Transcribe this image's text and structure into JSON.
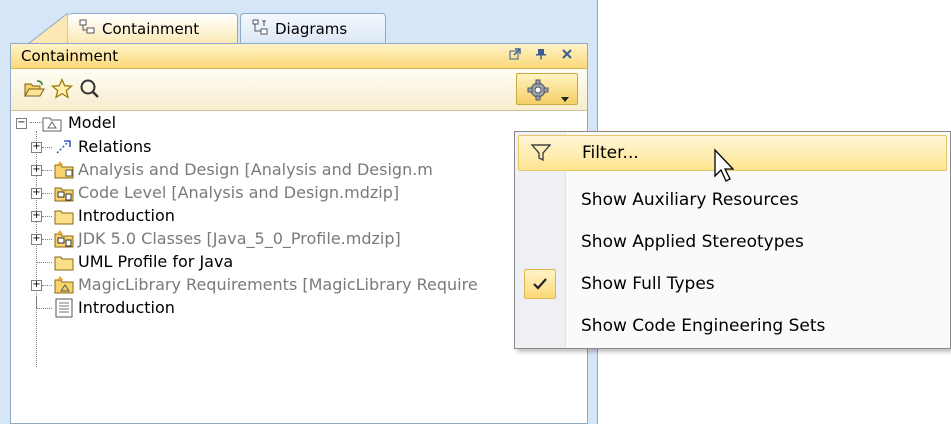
{
  "tabs": [
    {
      "label": "Containment",
      "icon": "containment-icon",
      "active": true
    },
    {
      "label": "Diagrams",
      "icon": "diagrams-icon",
      "active": false
    }
  ],
  "panel": {
    "title": "Containment",
    "header_buttons": [
      "popout-icon",
      "pin-icon",
      "close-icon"
    ]
  },
  "toolbar": {
    "buttons": [
      "open-folder-icon",
      "favorite-star-icon",
      "search-icon"
    ],
    "options_button": "gear-icon"
  },
  "tree": {
    "items": [
      {
        "label": "Model",
        "icon": "model-package-icon",
        "greyed": false
      },
      {
        "label": "Relations",
        "icon": "relations-icon",
        "greyed": false
      },
      {
        "label": "Analysis and Design [Analysis and Design.m",
        "icon": "shared-package-icon",
        "greyed": true
      },
      {
        "label": "Code Level [Analysis and Design.mdzip]",
        "icon": "profile-package-icon",
        "greyed": true
      },
      {
        "label": "Introduction",
        "icon": "package-folder-icon",
        "greyed": false
      },
      {
        "label": "JDK 5.0 Classes [Java_5_0_Profile.mdzip]",
        "icon": "profile-package-icon",
        "greyed": true
      },
      {
        "label": "UML Profile for Java",
        "icon": "package-folder-icon",
        "greyed": false
      },
      {
        "label": "MagicLibrary Requirements [MagicLibrary Require",
        "icon": "shared-package-icon",
        "greyed": true
      },
      {
        "label": "Introduction",
        "icon": "comment-document-icon",
        "greyed": false
      }
    ]
  },
  "menu": {
    "items": [
      {
        "label": "Filter...",
        "icon": "filter-icon",
        "checked": false,
        "highlighted": true
      },
      {
        "label": "Show Auxiliary Resources",
        "checked": false,
        "highlighted": false
      },
      {
        "label": "Show Applied Stereotypes",
        "checked": false,
        "highlighted": false
      },
      {
        "label": "Show Full Types",
        "checked": true,
        "highlighted": false
      },
      {
        "label": "Show Code Engineering Sets",
        "checked": false,
        "highlighted": false
      }
    ]
  },
  "colors": {
    "background": "#d7e6f7",
    "header_gold": "#fbd978",
    "highlight": "#fde58f",
    "grey_text": "#7a7a7a"
  }
}
